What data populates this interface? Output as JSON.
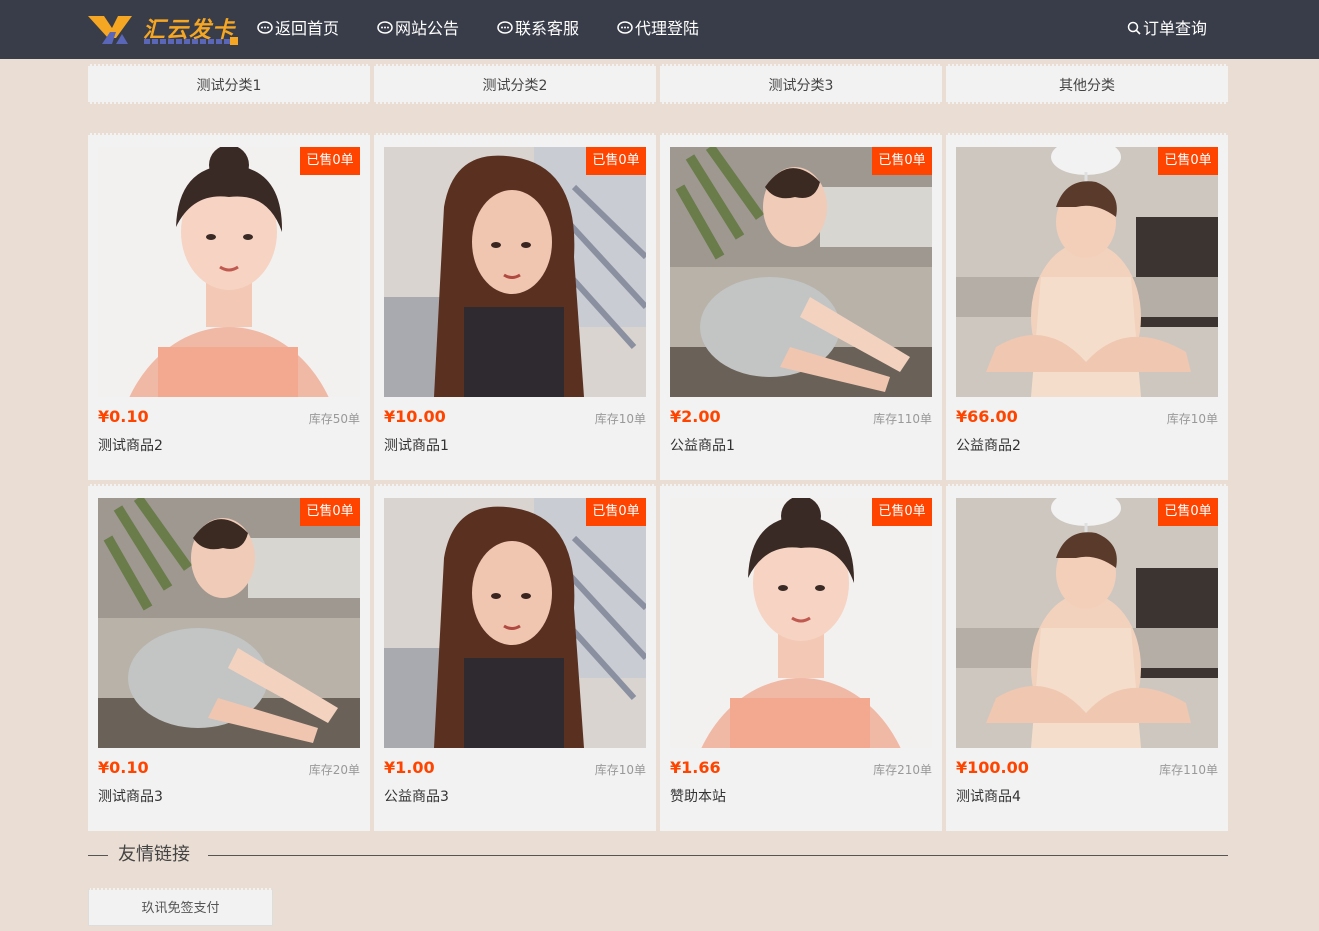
{
  "brand": {
    "name": "汇云发卡"
  },
  "nav": {
    "home": "返回首页",
    "notice": "网站公告",
    "service": "联系客服",
    "agent": "代理登陆",
    "query": "订单查询"
  },
  "categories": [
    "测试分类1",
    "测试分类2",
    "测试分类3",
    "其他分类"
  ],
  "products": [
    {
      "price": "¥0.10",
      "stock": "库存50单",
      "name": "测试商品2",
      "sold": "已售0单",
      "image": "photo-girl-white"
    },
    {
      "price": "¥10.00",
      "stock": "库存10单",
      "name": "测试商品1",
      "sold": "已售0单",
      "image": "photo-girl-longhair"
    },
    {
      "price": "¥2.00",
      "stock": "库存110单",
      "name": "公益商品1",
      "sold": "已售0单",
      "image": "photo-girl-sitting"
    },
    {
      "price": "¥66.00",
      "stock": "库存10单",
      "name": "公益商品2",
      "sold": "已售0单",
      "image": "photo-girl-floor"
    },
    {
      "price": "¥0.10",
      "stock": "库存20单",
      "name": "测试商品3",
      "sold": "已售0单",
      "image": "photo-girl-sitting"
    },
    {
      "price": "¥1.00",
      "stock": "库存10单",
      "name": "公益商品3",
      "sold": "已售0单",
      "image": "photo-girl-longhair"
    },
    {
      "price": "¥1.66",
      "stock": "库存210单",
      "name": "赞助本站",
      "sold": "已售0单",
      "image": "photo-girl-white"
    },
    {
      "price": "¥100.00",
      "stock": "库存110单",
      "name": "测试商品4",
      "sold": "已售0单",
      "image": "photo-girl-floor"
    }
  ],
  "friend_links": {
    "title": "友情链接",
    "items": [
      "玖讯免签支付"
    ]
  },
  "colors": {
    "topbar": "#393d49",
    "accent": "#ff4400",
    "background": "#e9ddd4",
    "card": "#f2f2f2"
  }
}
